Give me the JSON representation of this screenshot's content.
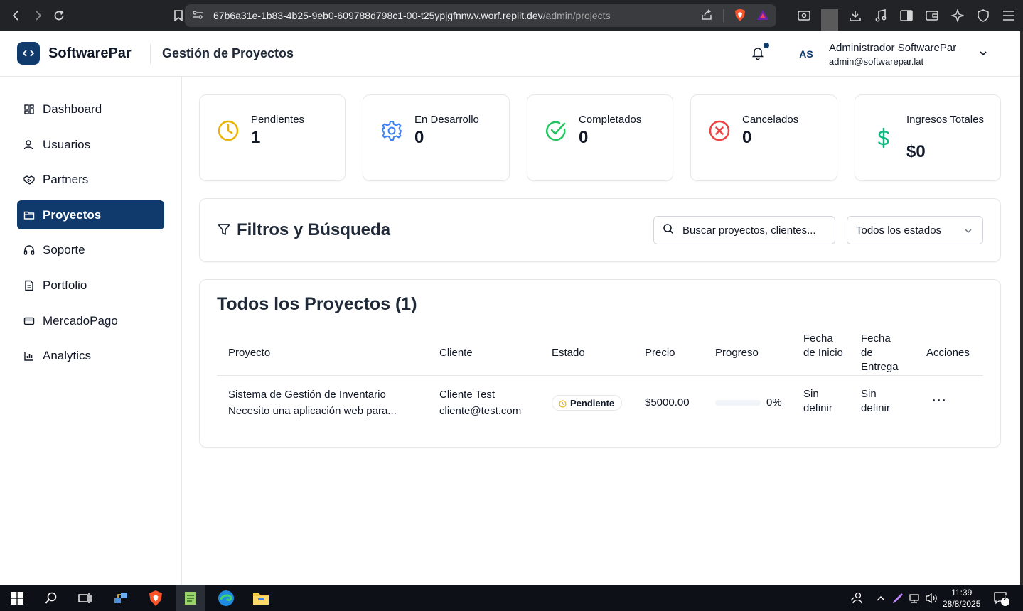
{
  "browser": {
    "url_host": "67b6a31e-1b83-4b25-9eb0-609788d798c1-00-t25ypjgfnnwv.worf.replit.dev",
    "url_path": "/admin/projects"
  },
  "header": {
    "brand": "SoftwarePar",
    "page_title": "Gestión de Proyectos",
    "avatar_initials": "AS",
    "user_name": "Administrador SoftwarePar",
    "user_email": "admin@softwarepar.lat"
  },
  "sidebar": {
    "items": [
      {
        "label": "Dashboard",
        "icon": "grid-icon"
      },
      {
        "label": "Usuarios",
        "icon": "user-icon"
      },
      {
        "label": "Partners",
        "icon": "handshake-icon"
      },
      {
        "label": "Proyectos",
        "icon": "folder-icon",
        "active": true
      },
      {
        "label": "Soporte",
        "icon": "headset-icon"
      },
      {
        "label": "Portfolio",
        "icon": "document-icon"
      },
      {
        "label": "MercadoPago",
        "icon": "card-icon"
      },
      {
        "label": "Analytics",
        "icon": "bar-chart-icon"
      }
    ]
  },
  "stats": [
    {
      "label": "Pendientes",
      "value": "1",
      "icon": "clock-icon",
      "color": "#eab308"
    },
    {
      "label": "En Desarrollo",
      "value": "0",
      "icon": "gear-icon",
      "color": "#3b82f6"
    },
    {
      "label": "Completados",
      "value": "0",
      "icon": "check-circle-icon",
      "color": "#22c55e"
    },
    {
      "label": "Cancelados",
      "value": "0",
      "icon": "x-circle-icon",
      "color": "#ef4444"
    },
    {
      "label": "Ingresos Totales",
      "value": "$0",
      "icon": "dollar-icon",
      "color": "#10b981"
    }
  ],
  "filters": {
    "title": "Filtros y Búsqueda",
    "search_placeholder": "Buscar proyectos, clientes...",
    "status_selected": "Todos los estados"
  },
  "projects": {
    "title": "Todos los Proyectos (1)",
    "columns": [
      "Proyecto",
      "Cliente",
      "Estado",
      "Precio",
      "Progreso",
      "Fecha de Inicio",
      "Fecha de Entrega",
      "Acciones"
    ],
    "rows": [
      {
        "name": "Sistema de Gestión de Inventario",
        "description": "Necesito una aplicación web para...",
        "client_name": "Cliente Test",
        "client_email": "cliente@test.com",
        "status": "Pendiente",
        "price": "$5000.00",
        "progress": 0,
        "progress_label": "0%",
        "start_date": "Sin definir",
        "delivery_date": "Sin definir",
        "actions": "···"
      }
    ]
  },
  "taskbar": {
    "time": "11:39",
    "date": "28/8/2025",
    "notifications": "2"
  }
}
